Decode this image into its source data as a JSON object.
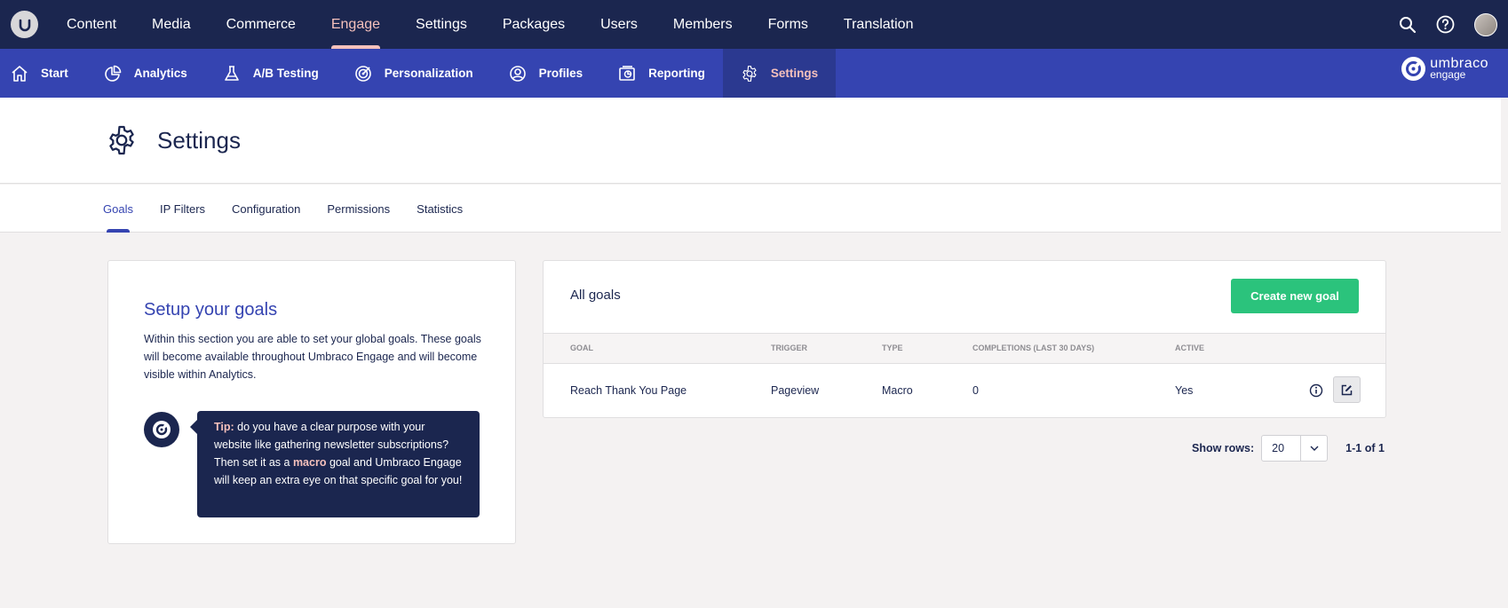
{
  "topnav": {
    "items": [
      "Content",
      "Media",
      "Commerce",
      "Engage",
      "Settings",
      "Packages",
      "Users",
      "Members",
      "Forms",
      "Translation"
    ],
    "active": "Engage"
  },
  "subnav": {
    "items": [
      {
        "label": "Start",
        "icon": "home-icon"
      },
      {
        "label": "Analytics",
        "icon": "pie-chart-icon"
      },
      {
        "label": "A/B Testing",
        "icon": "flask-icon"
      },
      {
        "label": "Personalization",
        "icon": "target-icon"
      },
      {
        "label": "Profiles",
        "icon": "profile-icon"
      },
      {
        "label": "Reporting",
        "icon": "report-icon"
      },
      {
        "label": "Settings",
        "icon": "gear-icon"
      }
    ],
    "active": "Settings"
  },
  "brand": {
    "line1": "umbraco",
    "line2": "engage"
  },
  "page": {
    "title": "Settings"
  },
  "tabs": {
    "items": [
      "Goals",
      "IP Filters",
      "Configuration",
      "Permissions",
      "Statistics"
    ],
    "active": "Goals"
  },
  "setup": {
    "title": "Setup your goals",
    "text": "Within this section you are able to set your global goals. These goals will become available throughout Umbraco Engage and will become visible within Analytics.",
    "tip_label": "Tip:",
    "tip_part1": " do you have a clear purpose with your website like gathering newsletter subscriptions? Then set it as a ",
    "tip_highlight": "macro",
    "tip_part2": " goal and Umbraco Engage will keep an extra eye on that specific goal for you!"
  },
  "goals": {
    "title": "All goals",
    "create_label": "Create new goal",
    "columns": [
      "Goal",
      "Trigger",
      "Type",
      "Completions (last 30 days)",
      "Active"
    ],
    "rows": [
      {
        "goal": "Reach Thank You Page",
        "trigger": "Pageview",
        "type": "Macro",
        "completions": "0",
        "active": "Yes"
      }
    ]
  },
  "pager": {
    "show_label": "Show rows:",
    "rows_value": "20",
    "range": "1-1 of 1"
  },
  "colors": {
    "topbar": "#1b264f",
    "subbar": "#3544b1",
    "accent": "#f5c1bc",
    "create": "#2bc37c"
  }
}
